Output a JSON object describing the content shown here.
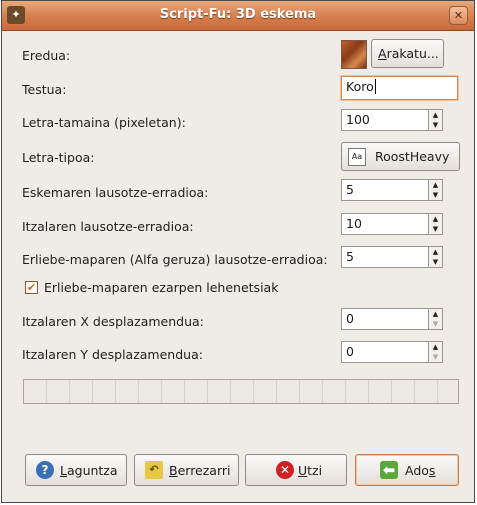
{
  "window": {
    "title": "Script-Fu: 3D eskema"
  },
  "fields": {
    "pattern": {
      "label": "Eredua:",
      "browse_label_prefix": "A",
      "browse_label_rest": "rakatu..."
    },
    "text": {
      "label": "Testua:",
      "value": "Koro"
    },
    "font_size": {
      "label": "Letra-tamaina (pixeletan):",
      "value": "100"
    },
    "font": {
      "label": "Letra-tipoa:",
      "value": "RoostHeavy",
      "icon_text": "Aa"
    },
    "outline_blur": {
      "label": "Eskemaren lausotze-erradioa:",
      "value": "5"
    },
    "shadow_blur": {
      "label": "Itzalaren lausotze-erradioa:",
      "value": "10"
    },
    "bump_blur": {
      "label": "Erliebe-maparen (Alfa geruza) lausotze-erradioa:",
      "value": "5"
    },
    "default_bump": {
      "label": "Erliebe-maparen ezarpen lehenetsiak",
      "checked": true
    },
    "shadow_x": {
      "label": "Itzalaren X desplazamendua:",
      "value": "0"
    },
    "shadow_y": {
      "label": "Itzalaren Y desplazamendua:",
      "value": "0"
    }
  },
  "progress": {
    "value": 0
  },
  "buttons": {
    "help": {
      "mnemonic": "L",
      "rest": "aguntza"
    },
    "reset": {
      "mnemonic": "B",
      "rest": "errezarri"
    },
    "cancel": {
      "mnemonic": "U",
      "rest": "tzi"
    },
    "ok": {
      "prefix": "Ado",
      "mnemonic": "s"
    }
  },
  "colors": {
    "titlebar": "#d98453",
    "accent": "#d7864f",
    "ok_icon": "#5aa83a",
    "cancel_icon": "#cc2222",
    "help_icon": "#3a6fb5"
  }
}
